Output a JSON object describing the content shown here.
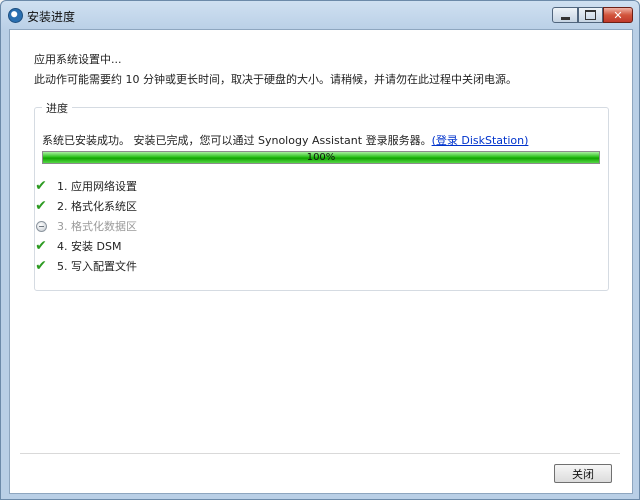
{
  "window": {
    "title": "安装进度"
  },
  "message": {
    "line1": "应用系统设置中...",
    "line2": "此动作可能需要约 10 分钟或更长时间，取决于硬盘的大小。请稍候，并请勿在此过程中关闭电源。"
  },
  "progress_group": {
    "legend": "进度",
    "status_text": "系统已安装成功。 安装已完成，您可以通过 Synology Assistant 登录服务器。",
    "link_text": "(登录 DiskStation)",
    "progress_label": "100%",
    "progress_fraction": 1.0,
    "progress_color": "#10a400"
  },
  "steps": [
    {
      "label": "1. 应用网络设置",
      "status": "done",
      "icon": "check-icon"
    },
    {
      "label": "2. 格式化系统区",
      "status": "done",
      "icon": "check-icon"
    },
    {
      "label": "3. 格式化数据区",
      "status": "skipped",
      "icon": "pending-icon"
    },
    {
      "label": "4. 安装 DSM",
      "status": "done",
      "icon": "check-icon"
    },
    {
      "label": "5. 写入配置文件",
      "status": "done",
      "icon": "check-icon"
    }
  ],
  "footer": {
    "close_label": "关闭"
  }
}
